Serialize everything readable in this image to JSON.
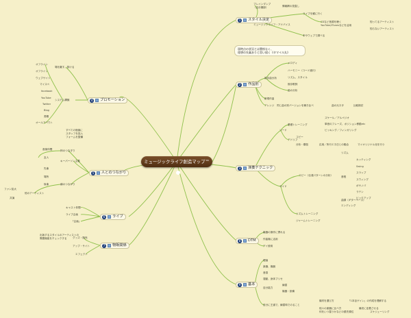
{
  "central": "ミュージックライフ創造マップ™",
  "note": [
    "現時点の状況とは関係なく、",
    "理想の先乗ありと思い描く《タマイル丸》"
  ],
  "topics": {
    "promotion": {
      "num": "4",
      "label": "プロモーション"
    },
    "people": {
      "num": "5",
      "label": "人とのつながり"
    },
    "live": {
      "num": "6",
      "label": "ライブ"
    },
    "business": {
      "num": "7",
      "label": "物販関係"
    },
    "style": {
      "num": "1",
      "label": "スタイル決定"
    },
    "works": {
      "num": "2",
      "label": "作品別"
    },
    "tech": {
      "num": "3",
      "label": "演奏テクニック"
    },
    "dtm": {
      "num": "8",
      "label": "DTM"
    },
    "basics": {
      "num": "9",
      "label": "基本"
    }
  },
  "leaves": {
    "promo_sub1": "場を離す、掛ける",
    "promo_sub2": "システム構築",
    "promo_items": [
      "オフライン",
      "オフライン",
      "ウェブサイト",
      "マイスペ",
      "facebook",
      "YouTube",
      "Twitter",
      "Blog",
      "書籍",
      "オールアバウト"
    ],
    "promo_note": [
      "すべての価値に",
      "スタッフを投入",
      "フォームを整備"
    ],
    "people_sub1": "柿のつなぎり",
    "people_sub2": "キーパーソン主義",
    "people_sub3": "横のつながり",
    "people_items": [
      "音楽仲間",
      "友人",
      "先輩",
      "場所",
      "後輩"
    ],
    "people_left": [
      "ファン拡大",
      "共演"
    ],
    "people_left2": "他のアーティスト",
    "live_items": [
      "キャスト仲間",
      "ライブ企画",
      "「企画」"
    ],
    "business_note": [
      "出版するスタイルのアーティストの",
      "需要機能をチェックする"
    ],
    "business_items": [
      "グッズ・販売",
      "アップ・サイト",
      "エフェクト"
    ],
    "style_items": [
      "ブレインダンプ",
      "（自分棚卸）",
      "情報網の見直し",
      "ライブを観に行く",
      "CDなど音源を聴く",
      "YouTube/iTunesなどを活用",
      "知ってるアーティスト",
      "知らないアーティスト",
      "ミュージックライフ・アドバイス",
      "本やウェブで調べる"
    ],
    "works_items": [
      "既存曲分析",
      "メロディ",
      "ハーモニー（コード進行）",
      "リズム、スタイル",
      "既存歌詞",
      "曲の分析",
      "新規作曲",
      "アレンジ",
      "同じ曲の別バージョンを聴き比べ",
      "曲の元ネタ",
      "比較検討"
    ],
    "tech_items": [
      "リード",
      "基礎トレーニング",
      "スケール／アルペジオ",
      "単音のフレーズ、ポジション移動etc",
      "ビッキング／フィンガリング",
      "アドリブ",
      "コピー",
      "分析・模倣",
      "応用／所行エネ日との融合",
      "マイオリジナル化を行う",
      "サイド",
      "コピー（伝達パターンの分析）",
      "リズム",
      "カッティング",
      "Swing",
      "音程",
      "スラップ",
      "スウィング",
      "ボサノバ",
      "ラテン",
      "ビックアップ",
      "曲調（ギターベース）",
      "エンディング",
      "リズムトレーニング",
      "ジャームトレーニング"
    ],
    "dtm_items": [
      "機器の操作に慣れる",
      "作曲機に活用",
      "アイ使用"
    ],
    "basic_items": [
      "理論",
      "楽器、機器",
      "音感",
      "運動、身体プリセ",
      "自分能力",
      "練習",
      "機器・設備",
      "自分に王道で、練習時でのること",
      "機材を選び方",
      "「1本目ゲイン」の作成を理解する",
      "他人の楽器に比べ方",
      "何をいつ習うかなどの優先順位",
      "最初に定着させる",
      "スケジューリング"
    ]
  }
}
